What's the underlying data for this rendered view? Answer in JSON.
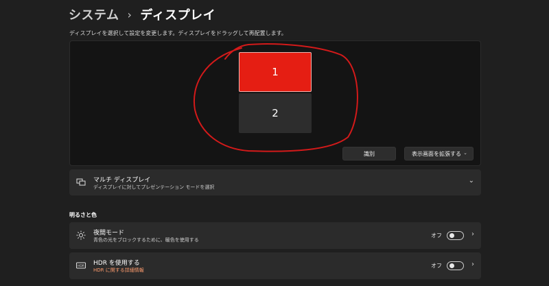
{
  "header": {
    "breadcrumb_root": "システム",
    "separator": "›",
    "breadcrumb_current": "ディスプレイ"
  },
  "instruction": "ディスプレイを選択して設定を変更します。ディスプレイをドラッグして再配置します。",
  "display_arrangement": {
    "monitors": [
      {
        "label": "1",
        "selected": true
      },
      {
        "label": "2",
        "selected": false
      }
    ],
    "identify_label": "識別",
    "mode_label": "表示画面を拡張する",
    "mode_chevron": "⌄",
    "annotation_color": "#d41a1a"
  },
  "multi_display": {
    "title": "マルチ ディスプレイ",
    "subtitle": "ディスプレイに対してプレゼンテーション モードを選択",
    "icon": "multi-monitor-icon",
    "chevron": "⌄"
  },
  "brightness_section": {
    "heading": "明るさと色"
  },
  "night_light": {
    "title": "夜間モード",
    "subtitle": "青色の光をブロックするために、暖色を使用する",
    "icon": "brightness-icon",
    "toggle_label": "オフ",
    "toggle_on": false,
    "chevron": "›"
  },
  "hdr": {
    "title": "HDR を使用する",
    "subtitle": "HDR に関する詳細情報",
    "icon_text": "HDR",
    "toggle_label": "オフ",
    "toggle_on": false,
    "chevron": "›"
  },
  "colors": {
    "background": "#1f1f1f",
    "card": "#2b2b2b",
    "selected_monitor": "#e51e13",
    "link": "#ff9c6e"
  }
}
